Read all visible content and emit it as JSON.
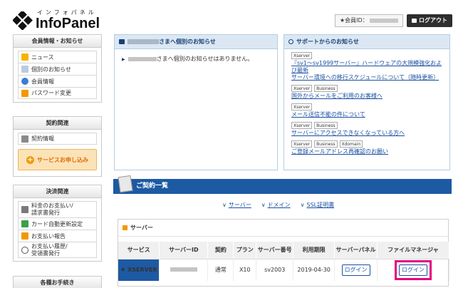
{
  "header": {
    "logo_kana": "インフォパネル",
    "logo_text": "InfoPanel",
    "member_label": "★会員ID：",
    "logout_label": "ログアウト"
  },
  "sidebar": {
    "member_info": {
      "title": "会員情報・お知らせ",
      "items": [
        {
          "label": "ニュース",
          "icon": "news-icon"
        },
        {
          "label": "個別のお知らせ",
          "icon": "notice-icon"
        },
        {
          "label": "会員情報",
          "icon": "user-icon"
        },
        {
          "label": "パスワード変更",
          "icon": "key-icon"
        }
      ]
    },
    "contract": {
      "title": "契約関連",
      "items": [
        {
          "label": "契約情報",
          "icon": "contract-icon"
        }
      ],
      "apply_label": "サービスお申し込み"
    },
    "payment": {
      "title": "決済関連",
      "items": [
        {
          "label": "料金のお支払い/",
          "label2": "請求書発行",
          "icon": "payment-icon"
        },
        {
          "label": "カード自動更新設定",
          "icon": "card-icon"
        },
        {
          "label": "お支払い報告",
          "icon": "report-icon"
        },
        {
          "label": "お支払い履歴/",
          "label2": "受領書発行",
          "icon": "history-icon"
        }
      ]
    },
    "procedures": {
      "title": "各種お手続き"
    }
  },
  "notices": {
    "title_suffix": "さまへ個別のお知らせ",
    "line_suffix": "さまへ個別のお知らせはありません。"
  },
  "support": {
    "title": "サポートからのお知らせ",
    "items": [
      {
        "tags": [
          "Xserver"
        ],
        "lines": [
          "『sv1〜sv1999サーバー』ハードウェアの大規模強化および最新",
          "サーバー環境への移行スケジュールについて（随時更新）"
        ]
      },
      {
        "tags": [
          "Xserver",
          "Business"
        ],
        "lines": [
          "国外からメールをご利用のお客様へ"
        ]
      },
      {
        "tags": [
          "Xserver"
        ],
        "lines": [
          "メール送信不能の件について"
        ]
      },
      {
        "tags": [
          "Xserver",
          "Business"
        ],
        "lines": [
          "サーバーにアクセスできなくなっている方へ"
        ]
      },
      {
        "tags": [
          "Xserver",
          "Business",
          "Xdomain"
        ],
        "lines": [
          "ご登録メールアドレス再確認のお願い"
        ]
      }
    ]
  },
  "contracts": {
    "title": "ご契約一覧",
    "anchors": [
      "サーバー",
      "ドメイン",
      "SSL証明書"
    ],
    "server_section_title": "サーバー",
    "columns": [
      "サービス",
      "サーバーID",
      "契約",
      "プラン",
      "サーバー番号",
      "利用期限",
      "サーバーパネル",
      "ファイルマネージャ"
    ],
    "row": {
      "service": "XSERVER",
      "contract": "通常",
      "plan": "X10",
      "server_no": "sv2003",
      "expiry": "2019-04-30",
      "panel_login": "ログイン",
      "fm_login": "ログイン"
    }
  },
  "colors": {
    "brand_blue": "#1d5aa3",
    "highlight": "#e4007f",
    "accent_orange": "#f39800"
  }
}
